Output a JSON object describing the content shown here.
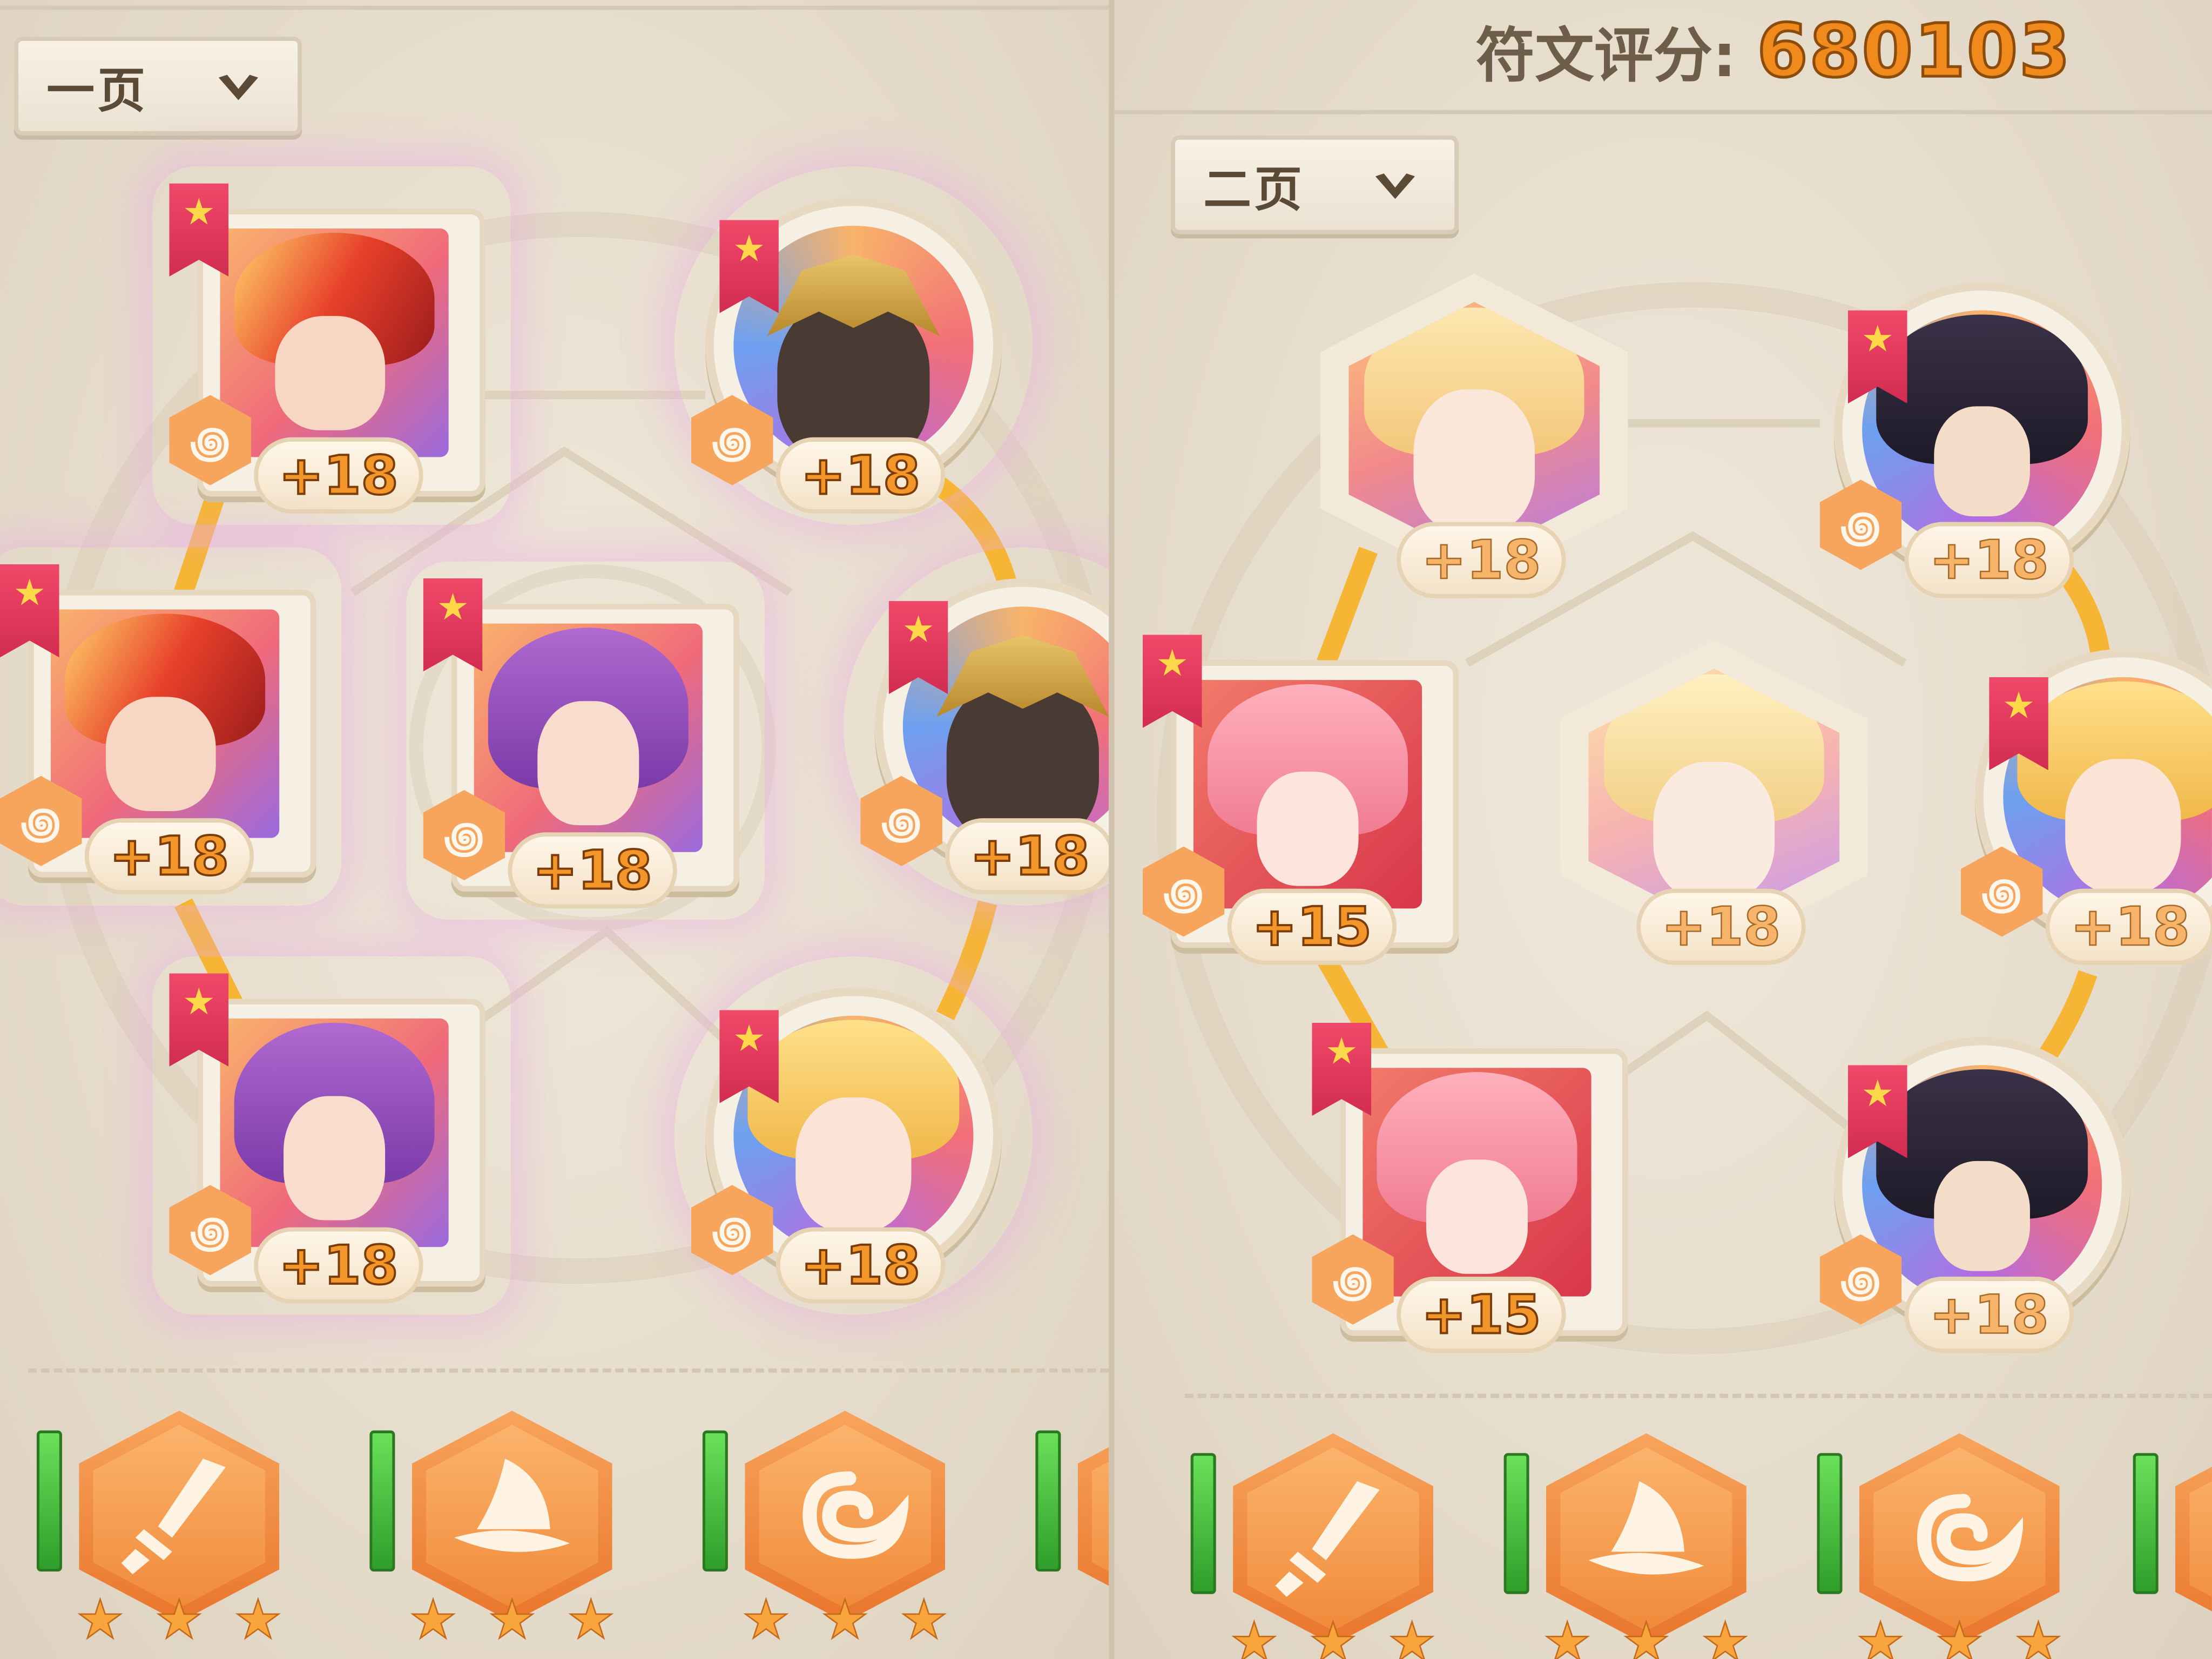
{
  "left_panel": {
    "page_label": "一页"
  },
  "right_panel": {
    "score_label": "符文评分:",
    "score_value": "680103",
    "page_label": "二页"
  },
  "slots": {
    "l1": {
      "level": "+18"
    },
    "l2": {
      "level": "+18"
    },
    "l3": {
      "level": "+18"
    },
    "l4": {
      "level": "+18"
    },
    "l5": {
      "level": "+18"
    },
    "l6": {
      "level": "+18"
    },
    "l7": {
      "level": "+18"
    },
    "r1": {
      "level": "+18"
    },
    "r2": {
      "level": "+18"
    },
    "r3": {
      "level": "+15"
    },
    "r4": {
      "level": "+18"
    },
    "r5": {
      "level": "+18"
    },
    "r6": {
      "level": "+15"
    },
    "r7": {
      "level": "+18"
    }
  },
  "skills": [
    "sword-icon",
    "witch-hat-icon",
    "swirl-icon",
    "sword-icon",
    "witch-hat-icon",
    "swirl-icon"
  ],
  "colors": {
    "accent_orange": "#f08a1c",
    "ribbon_red": "#e23a5c",
    "path_gold": "#f6b534",
    "green_bar": "#3fbf3a"
  }
}
